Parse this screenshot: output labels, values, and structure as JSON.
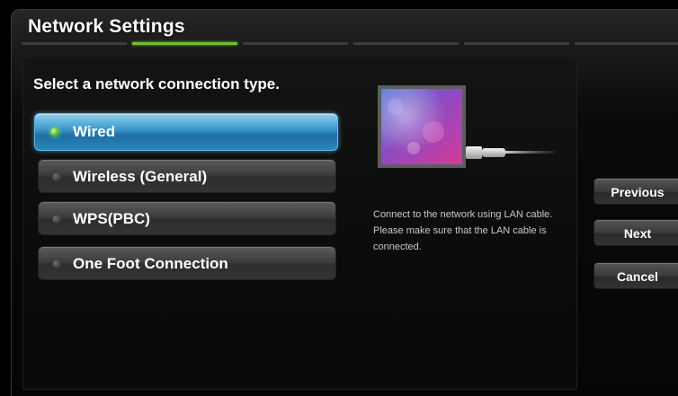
{
  "header": {
    "title": "Network Settings"
  },
  "steps": {
    "count": 6,
    "active_index": 1,
    "active_color": "#6fbf3a"
  },
  "panel": {
    "prompt": "Select a network connection type.",
    "options": [
      {
        "label": "Wired",
        "selected": true
      },
      {
        "label": "Wireless (General)",
        "selected": false
      },
      {
        "label": "WPS(PBC)",
        "selected": false
      },
      {
        "label": "One Foot Connection",
        "selected": false
      }
    ],
    "illustration": "tv-lan-cable-illustration",
    "description": "Connect to the network using LAN cable. Please make sure that the LAN cable is connected."
  },
  "buttons": {
    "previous": "Previous",
    "next": "Next",
    "cancel": "Cancel"
  },
  "colors": {
    "selection": "#2a86ba",
    "selected_indicator": "#55b81e"
  }
}
